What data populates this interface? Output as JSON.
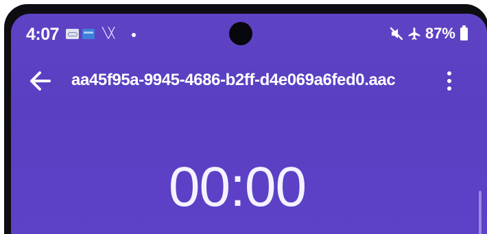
{
  "status_bar": {
    "time": "4:07",
    "notification_icons": [
      "voicemail-icon",
      "card-icon",
      "link-icon",
      "dot-icon"
    ],
    "link_glyph": "╲╳",
    "battery": "87%",
    "right_icons": [
      "mute-icon",
      "airplane-icon",
      "battery-icon"
    ]
  },
  "app_bar": {
    "title": "aa45f95a-9945-4686-b2ff-d4e069a6fed0.aac",
    "back_icon": "arrow-left-icon",
    "menu_icon": "more-vert-icon"
  },
  "player": {
    "elapsed_time": "00:00"
  },
  "colors": {
    "background": "#5d41c7",
    "text": "#ffffff"
  }
}
